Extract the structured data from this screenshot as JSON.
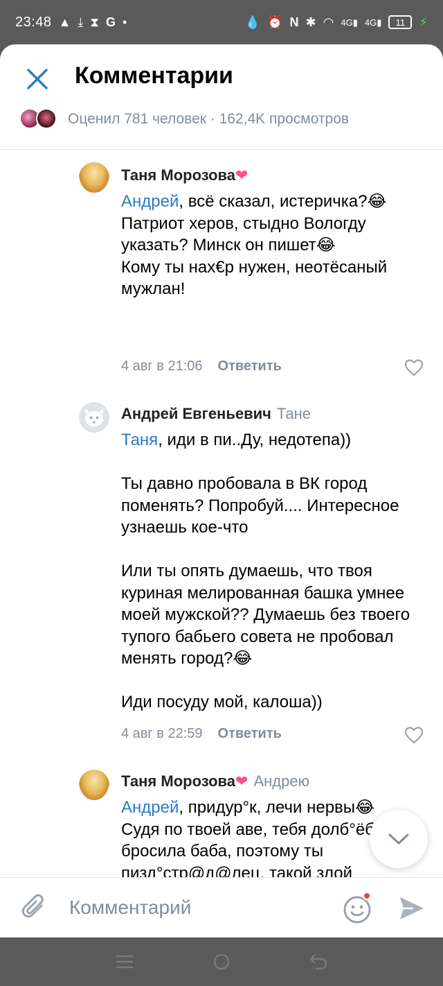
{
  "status_bar": {
    "time": "23:48",
    "left_icons": [
      "warning-icon",
      "download-icon",
      "hourglass-icon",
      "google-icon",
      "dot-icon"
    ],
    "right_icons": [
      "drop-icon",
      "alarm-icon",
      "nfc-icon",
      "bluetooth-icon",
      "wifi-icon",
      "signal-4g-icon",
      "signal-4g-icon"
    ],
    "battery": "11"
  },
  "header": {
    "title": "Комментарии",
    "stats": "Оценил 781 человек · 162,4K просмотров"
  },
  "comments": [
    {
      "author": "Таня Морозова",
      "author_badge": "❤",
      "reply_to": "",
      "mention": "Андрей",
      "text": ", всё сказал, истеричка?😂\nПатриот херов, стыдно Вологду указать? Минск он пишет😂\nКому ты нах€р нужен, неотёсаный мужлан!",
      "date": "4 авг в 21:06",
      "reply_label": "Ответить"
    },
    {
      "author": "Андрей Евгеньевич",
      "author_badge": "",
      "reply_to": "Тане",
      "mention": "Таня",
      "text": ", иди в пи..Ду, недотепа))\n\nТы давно пробовала в ВК город поменять? Попробуй.... Интересное узнаешь кое-что\n\nИли ты опять думаешь, что твоя куриная мелированная башка умнее моей мужской?? Думаешь без твоего тупого бабьего совета не пробовал менять город?😂\n\nИди посуду мой, калоша))",
      "date": "4 авг в 22:59",
      "reply_label": "Ответить"
    },
    {
      "author": "Таня Морозова",
      "author_badge": "❤",
      "reply_to": "Андрею",
      "mention": "Андрей",
      "text": ", придур°к, лечи нервы😂\nСудя по твоей аве, тебя долб°ёба бросила баба, поэтому ты пизд°стр@д@лец, такой злой\nВ-СЕ-ГО ХО-РО-ШЕ-ГО🤡!!!",
      "date": "",
      "reply_label": ""
    }
  ],
  "composer": {
    "placeholder": "Комментарий"
  },
  "nav_bar": {
    "icons": [
      "menu-icon",
      "home-icon",
      "back-icon"
    ]
  },
  "colors": {
    "accent": "#2a7ac6",
    "secondary_text": "#818c99",
    "system_bar": "#5a5a5a"
  }
}
